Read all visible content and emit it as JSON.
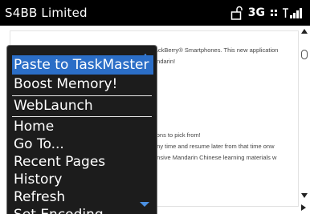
{
  "status_bar": {
    "carrier": "S4BB Limited",
    "network": "3G"
  },
  "page": {
    "lines": [
      "lackBerry® Smartphones. This new application",
      "andarin!",
      "sons to pick from!",
      "any time and resume later from that time onw",
      "ensive Mandarin Chinese learning materials w"
    ]
  },
  "menu": {
    "items": [
      "Paste to TaskMaster",
      "Boost Memory!",
      "WebLaunch",
      "Home",
      "Go To...",
      "Recent Pages",
      "History",
      "Refresh",
      "Set Encoding"
    ],
    "selected_index": 0
  },
  "colors": {
    "selection": "#2b6ec7",
    "menu_background": "#1c1c1c"
  }
}
